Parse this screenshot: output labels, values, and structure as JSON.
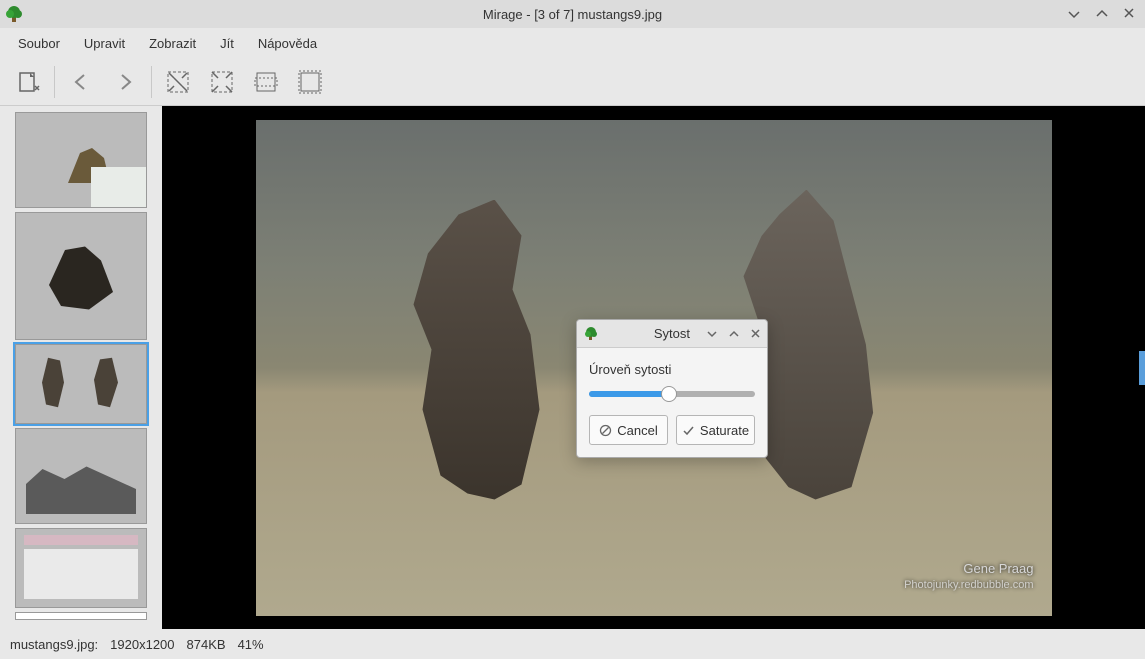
{
  "titlebar": {
    "title": "Mirage - [3 of 7] mustangs9.jpg"
  },
  "menu": {
    "file": "Soubor",
    "edit": "Upravit",
    "view": "Zobrazit",
    "go": "Jít",
    "help": "Nápověda"
  },
  "watermark": {
    "author": "Gene Praag",
    "site": "Photojunky.redbubble.com"
  },
  "dialog": {
    "title": "Sytost",
    "label": "Úroveň sytosti",
    "cancel": "Cancel",
    "confirm": "Saturate",
    "value_percent": 48
  },
  "status": {
    "filename": "mustangs9.jpg:",
    "dimensions": "1920x1200",
    "size": "874KB",
    "zoom": "41%"
  }
}
